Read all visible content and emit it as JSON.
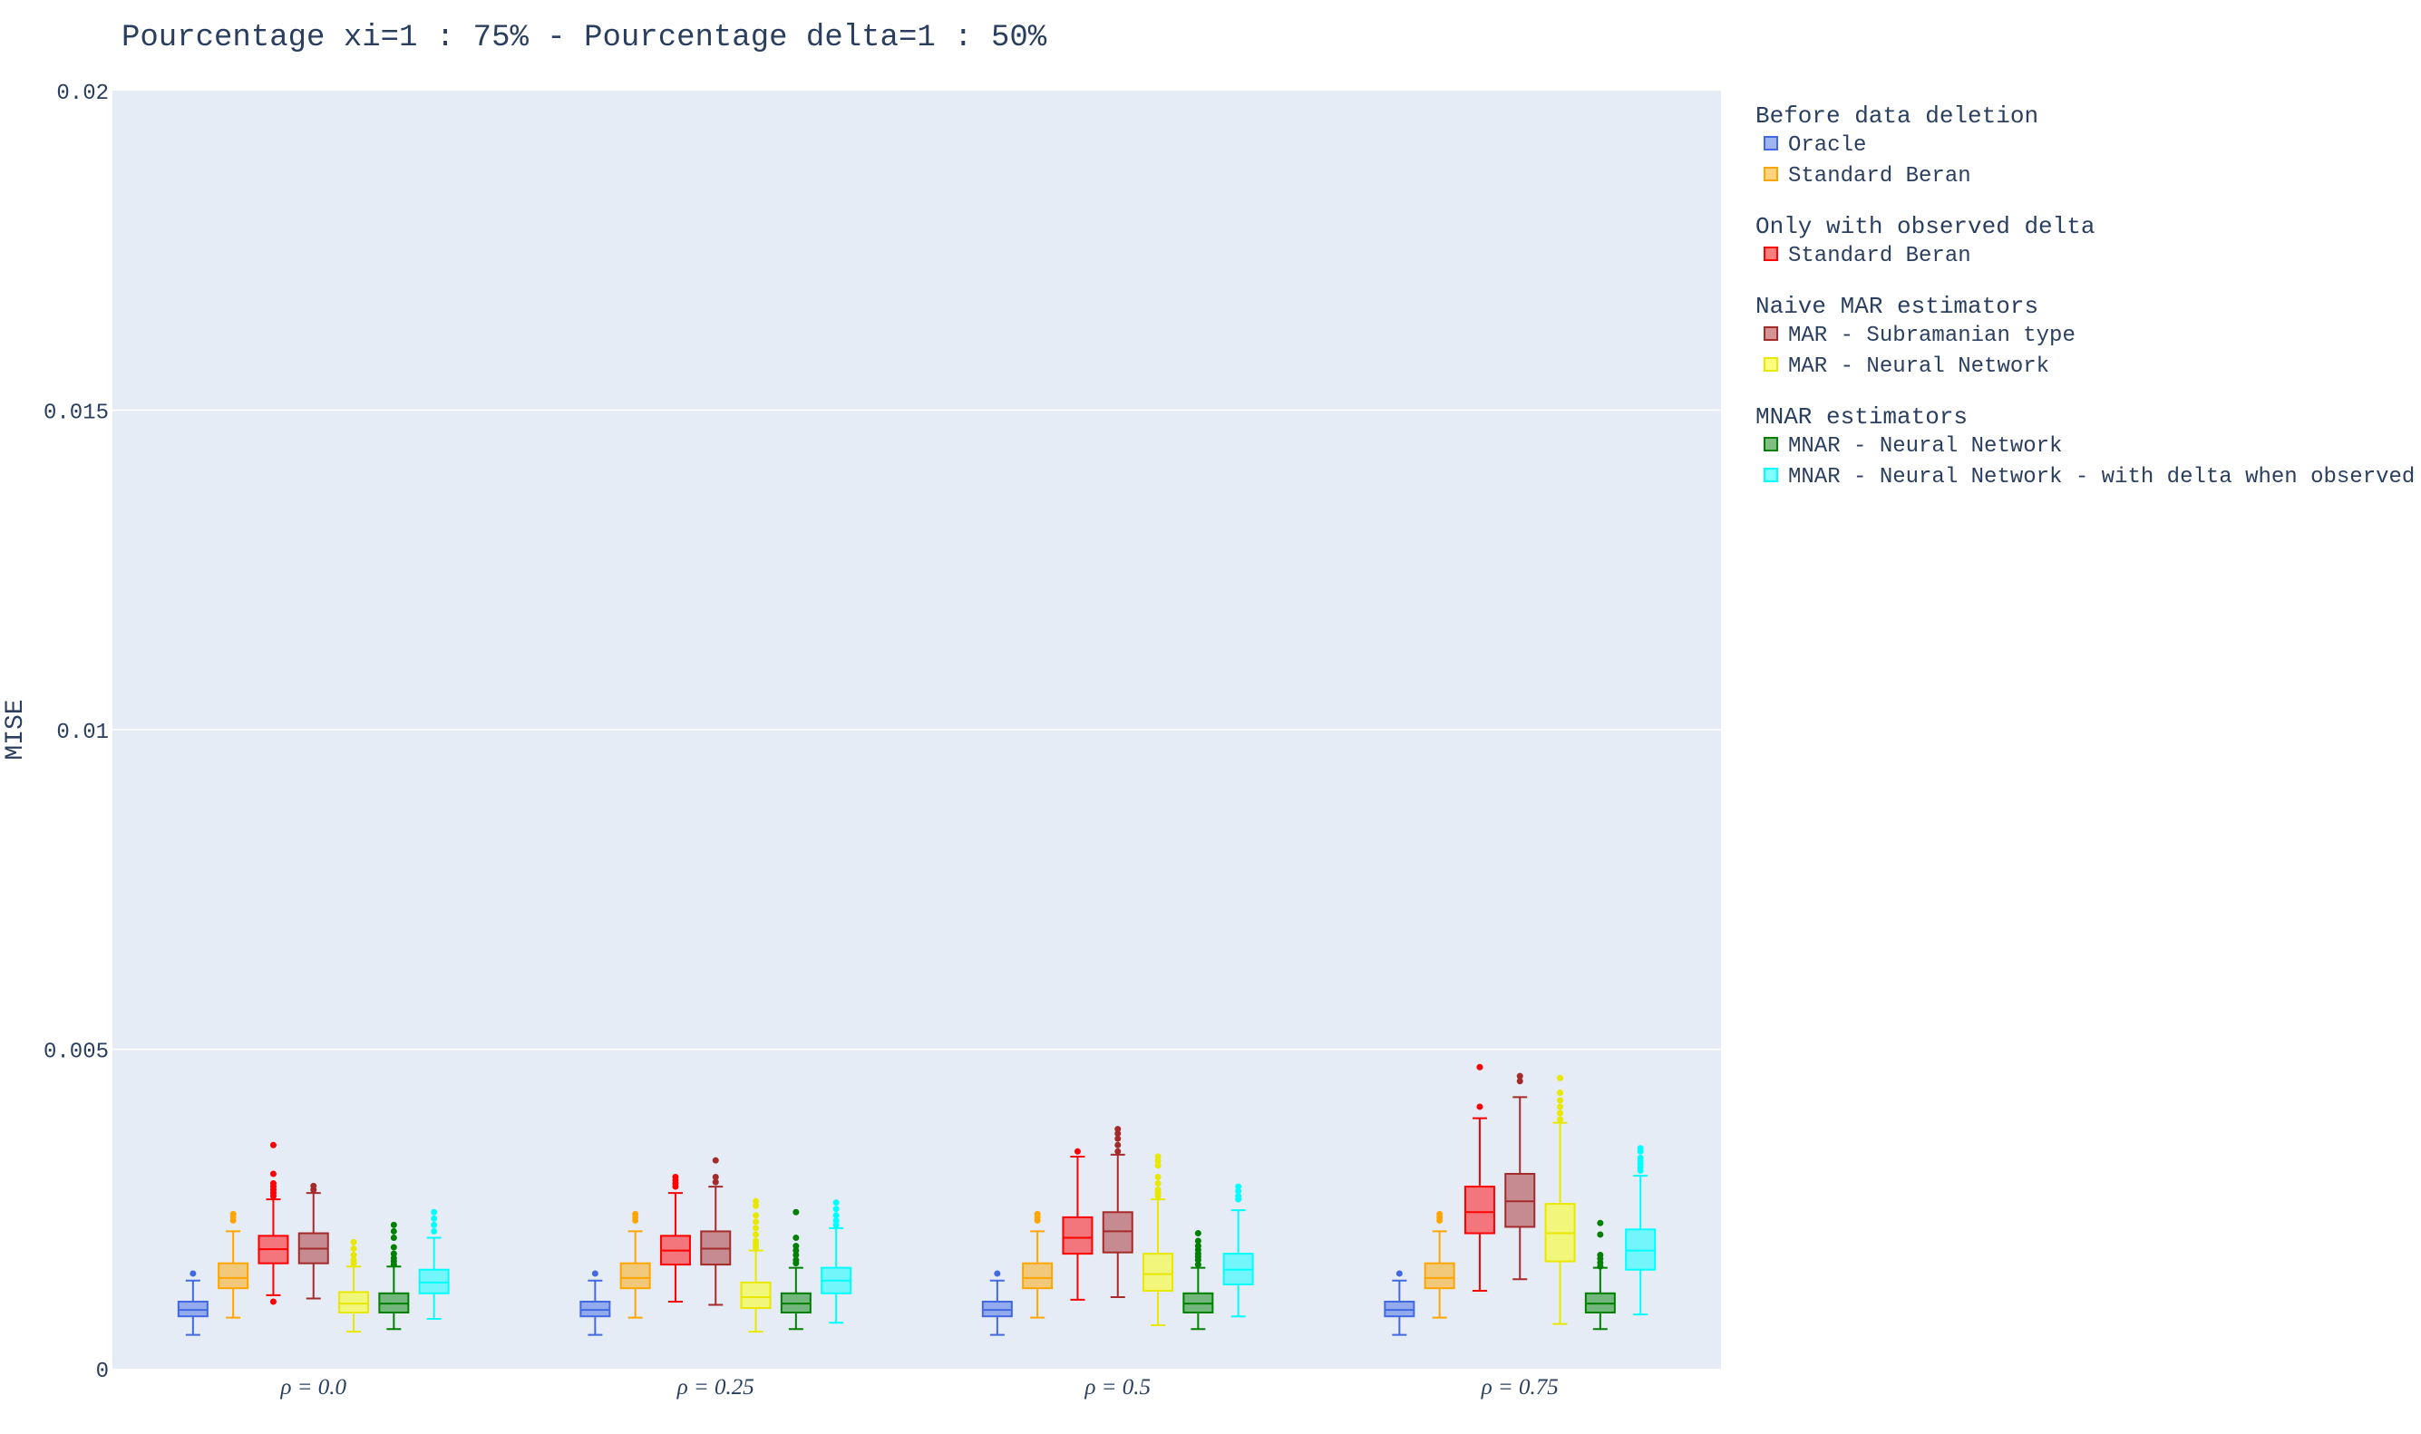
{
  "chart_data": {
    "type": "box",
    "title": "Pourcentage xi=1 : 75% - Pourcentage delta=1 : 50%",
    "ylabel": "MISE",
    "ylim": [
      0,
      0.02
    ],
    "yticks": [
      "0",
      "0.005",
      "0.01",
      "0.015",
      "0.02"
    ],
    "categories": [
      "ρ = 0.0",
      "ρ = 0.25",
      "ρ = 0.5",
      "ρ = 0.75"
    ],
    "grid": true,
    "legend_position": "right",
    "legend_groups": [
      {
        "title": "Before data deletion",
        "items": [
          0,
          1
        ]
      },
      {
        "title": "Only with observed delta",
        "items": [
          2
        ]
      },
      {
        "title": "Naive MAR estimators",
        "items": [
          3,
          4
        ]
      },
      {
        "title": "MNAR estimators",
        "items": [
          5,
          6
        ]
      }
    ],
    "series": [
      {
        "name": "Oracle",
        "color": "#4169e1",
        "boxes": [
          {
            "min": 0.00053,
            "q1": 0.00082,
            "median": 0.00092,
            "q3": 0.00105,
            "max": 0.00138,
            "outliers": [
              0.00149
            ]
          },
          {
            "min": 0.00053,
            "q1": 0.00082,
            "median": 0.00092,
            "q3": 0.00105,
            "max": 0.00138,
            "outliers": [
              0.00149
            ]
          },
          {
            "min": 0.00053,
            "q1": 0.00082,
            "median": 0.00092,
            "q3": 0.00105,
            "max": 0.00138,
            "outliers": [
              0.00149
            ]
          },
          {
            "min": 0.00053,
            "q1": 0.00082,
            "median": 0.00092,
            "q3": 0.00105,
            "max": 0.00138,
            "outliers": [
              0.00149
            ]
          }
        ]
      },
      {
        "name": "Standard Beran",
        "color": "#ffa500",
        "boxes": [
          {
            "min": 0.0008,
            "q1": 0.00126,
            "median": 0.00142,
            "q3": 0.00165,
            "max": 0.00215,
            "outliers": [
              0.00232,
              0.00237,
              0.00242
            ]
          },
          {
            "min": 0.0008,
            "q1": 0.00126,
            "median": 0.00142,
            "q3": 0.00165,
            "max": 0.00215,
            "outliers": [
              0.00232,
              0.00237,
              0.00242
            ]
          },
          {
            "min": 0.0008,
            "q1": 0.00126,
            "median": 0.00142,
            "q3": 0.00165,
            "max": 0.00215,
            "outliers": [
              0.00232,
              0.00237,
              0.00242
            ]
          },
          {
            "min": 0.0008,
            "q1": 0.00126,
            "median": 0.00142,
            "q3": 0.00165,
            "max": 0.00215,
            "outliers": [
              0.00232,
              0.00237,
              0.00242
            ]
          }
        ]
      },
      {
        "name": "Standard Beran",
        "color": "#ff0000",
        "boxes": [
          {
            "min": 0.00115,
            "q1": 0.00165,
            "median": 0.00187,
            "q3": 0.00208,
            "max": 0.00265,
            "outliers": [
              0.00105,
              0.0027,
              0.00275,
              0.0028,
              0.00285,
              0.0029,
              0.00305,
              0.0035
            ]
          },
          {
            "min": 0.00105,
            "q1": 0.00163,
            "median": 0.00185,
            "q3": 0.00208,
            "max": 0.00275,
            "outliers": [
              0.00285,
              0.0029,
              0.00295,
              0.003
            ]
          },
          {
            "min": 0.00108,
            "q1": 0.0018,
            "median": 0.00205,
            "q3": 0.00237,
            "max": 0.00332,
            "outliers": [
              0.0034
            ]
          },
          {
            "min": 0.00122,
            "q1": 0.00212,
            "median": 0.00245,
            "q3": 0.00285,
            "max": 0.00392,
            "outliers": [
              0.0041,
              0.00472
            ]
          }
        ]
      },
      {
        "name": "MAR - Subramanian type",
        "color": "#a52a2a",
        "boxes": [
          {
            "min": 0.0011,
            "q1": 0.00165,
            "median": 0.00188,
            "q3": 0.00212,
            "max": 0.00275,
            "outliers": [
              0.0028,
              0.00286
            ]
          },
          {
            "min": 0.001,
            "q1": 0.00163,
            "median": 0.00188,
            "q3": 0.00215,
            "max": 0.00285,
            "outliers": [
              0.00292,
              0.003,
              0.00326
            ]
          },
          {
            "min": 0.00112,
            "q1": 0.00182,
            "median": 0.00215,
            "q3": 0.00245,
            "max": 0.00335,
            "outliers": [
              0.0034,
              0.0035,
              0.0036,
              0.00368,
              0.00375
            ]
          },
          {
            "min": 0.0014,
            "q1": 0.00222,
            "median": 0.00262,
            "q3": 0.00305,
            "max": 0.00425,
            "outliers": [
              0.0045,
              0.00458
            ]
          }
        ]
      },
      {
        "name": "MAR - Neural Network",
        "color": "#ffff00",
        "boxes": [
          {
            "min": 0.00058,
            "q1": 0.00088,
            "median": 0.00102,
            "q3": 0.0012,
            "max": 0.0016,
            "outliers": [
              0.00165,
              0.0017,
              0.00178,
              0.00188,
              0.00198
            ]
          },
          {
            "min": 0.00058,
            "q1": 0.00095,
            "median": 0.00112,
            "q3": 0.00135,
            "max": 0.00185,
            "outliers": [
              0.0019,
              0.00195,
              0.002,
              0.0021,
              0.0022,
              0.0023,
              0.0024,
              0.00255,
              0.00262
            ]
          },
          {
            "min": 0.00068,
            "q1": 0.00122,
            "median": 0.00148,
            "q3": 0.0018,
            "max": 0.00265,
            "outliers": [
              0.0027,
              0.00275,
              0.0028,
              0.0029,
              0.003,
              0.00318,
              0.00325,
              0.00332
            ]
          },
          {
            "min": 0.0007,
            "q1": 0.00168,
            "median": 0.00212,
            "q3": 0.00258,
            "max": 0.00385,
            "outliers": [
              0.0039,
              0.004,
              0.0041,
              0.0042,
              0.00432,
              0.00455
            ]
          }
        ]
      },
      {
        "name": "MNAR - Neural Network",
        "color": "#008000",
        "boxes": [
          {
            "min": 0.00062,
            "q1": 0.00088,
            "median": 0.00102,
            "q3": 0.00118,
            "max": 0.0016,
            "outliers": [
              0.00163,
              0.00168,
              0.00173,
              0.0018,
              0.0019,
              0.00205,
              0.00215,
              0.00225
            ]
          },
          {
            "min": 0.00062,
            "q1": 0.00088,
            "median": 0.00102,
            "q3": 0.00118,
            "max": 0.00158,
            "outliers": [
              0.00165,
              0.0017,
              0.00178,
              0.00185,
              0.00192,
              0.00205,
              0.00245
            ]
          },
          {
            "min": 0.00062,
            "q1": 0.00088,
            "median": 0.00102,
            "q3": 0.00118,
            "max": 0.00158,
            "outliers": [
              0.00163,
              0.0017,
              0.00175,
              0.0018,
              0.00186,
              0.00192,
              0.002,
              0.00212
            ]
          },
          {
            "min": 0.00062,
            "q1": 0.00088,
            "median": 0.00102,
            "q3": 0.00118,
            "max": 0.00158,
            "outliers": [
              0.0016,
              0.00166,
              0.00172,
              0.00178,
              0.0021,
              0.00228
            ]
          }
        ]
      },
      {
        "name": "MNAR - Neural Network - with delta when observed",
        "color": "#00ffff",
        "boxes": [
          {
            "min": 0.00078,
            "q1": 0.00118,
            "median": 0.00135,
            "q3": 0.00155,
            "max": 0.00205,
            "outliers": [
              0.00215,
              0.00225,
              0.00235,
              0.00245
            ]
          },
          {
            "min": 0.00072,
            "q1": 0.00118,
            "median": 0.00138,
            "q3": 0.00158,
            "max": 0.0022,
            "outliers": [
              0.00225,
              0.00232,
              0.0024,
              0.0025,
              0.0026
            ]
          },
          {
            "min": 0.00082,
            "q1": 0.00132,
            "median": 0.00155,
            "q3": 0.0018,
            "max": 0.00248,
            "outliers": [
              0.00265,
              0.0027,
              0.00278,
              0.00285
            ]
          },
          {
            "min": 0.00085,
            "q1": 0.00155,
            "median": 0.00185,
            "q3": 0.00218,
            "max": 0.00302,
            "outliers": [
              0.0031,
              0.00315,
              0.0032,
              0.00325,
              0.0033,
              0.0034,
              0.00345
            ]
          }
        ]
      }
    ]
  }
}
